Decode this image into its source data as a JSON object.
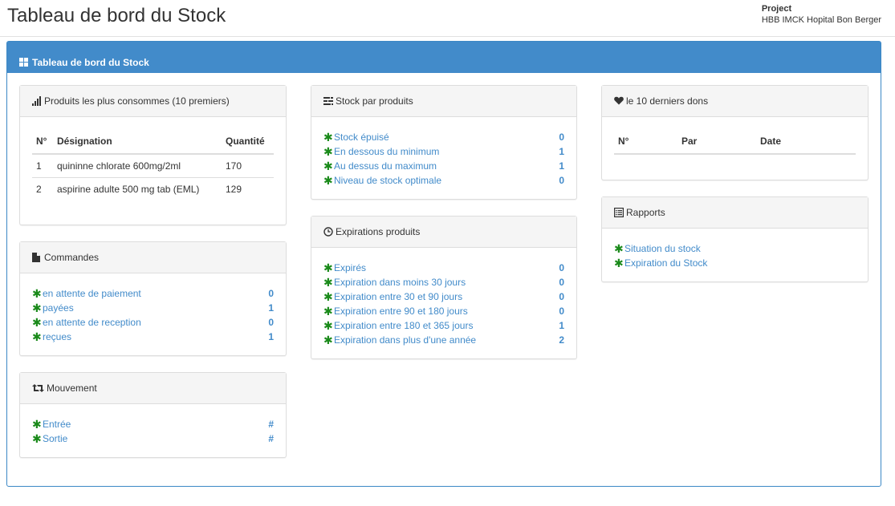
{
  "header": {
    "title": "Tableau de bord du Stock",
    "project_label": "Project",
    "project_name": "HBB IMCK Hopital Bon Berger"
  },
  "main": {
    "heading": "Tableau de bord du Stock"
  },
  "consumed": {
    "heading": "Produits les plus consommes (10 premiers)",
    "columns": [
      "N°",
      "Désignation",
      "Quantité"
    ],
    "rows": [
      [
        "1",
        "quininne chlorate 600mg/2ml",
        "170"
      ],
      [
        "2",
        "aspirine adulte 500 mg tab (EML)",
        "129"
      ]
    ]
  },
  "orders": {
    "heading": "Commandes",
    "items": [
      {
        "label": "en attente de paiement",
        "value": "0"
      },
      {
        "label": "payées",
        "value": "1"
      },
      {
        "label": "en attente de reception",
        "value": "0"
      },
      {
        "label": "reçues",
        "value": "1"
      }
    ]
  },
  "movement": {
    "heading": "Mouvement",
    "items": [
      {
        "label": "Entrée",
        "value": "#"
      },
      {
        "label": "Sortie",
        "value": "#"
      }
    ]
  },
  "stock": {
    "heading": "Stock par produits",
    "items": [
      {
        "label": "Stock épuisé",
        "value": "0"
      },
      {
        "label": "En dessous du minimum",
        "value": "1"
      },
      {
        "label": "Au dessus du maximum",
        "value": "1"
      },
      {
        "label": "Niveau de stock optimale",
        "value": "0"
      }
    ]
  },
  "expirations": {
    "heading": "Expirations produits",
    "items": [
      {
        "label": "Expirés",
        "value": "0"
      },
      {
        "label": "Expiration dans moins 30 jours",
        "value": "0"
      },
      {
        "label": "Expiration entre 30 et 90 jours",
        "value": "0"
      },
      {
        "label": "Expiration entre 90 et 180 jours",
        "value": "0"
      },
      {
        "label": "Expiration entre 180 et 365 jours",
        "value": "1"
      },
      {
        "label": "Expiration dans plus d'une année",
        "value": "2"
      }
    ]
  },
  "donations": {
    "heading": "le 10 derniers dons",
    "columns": [
      "N°",
      "Par",
      "Date"
    ]
  },
  "reports": {
    "heading": "Rapports",
    "items": [
      {
        "label": "Situation du stock"
      },
      {
        "label": "Expiration du Stock"
      }
    ]
  },
  "colors": {
    "primary": "#428bca",
    "bullet": "#1a8a1a"
  },
  "icons": {
    "main": "th-large-icon",
    "consumed": "signal-icon",
    "orders": "file-icon",
    "movement": "retweet-icon",
    "stock": "tasks-icon",
    "expirations": "clock-icon",
    "donations": "heart-icon",
    "reports": "list-alt-icon",
    "bullet": "asterisk-icon"
  }
}
